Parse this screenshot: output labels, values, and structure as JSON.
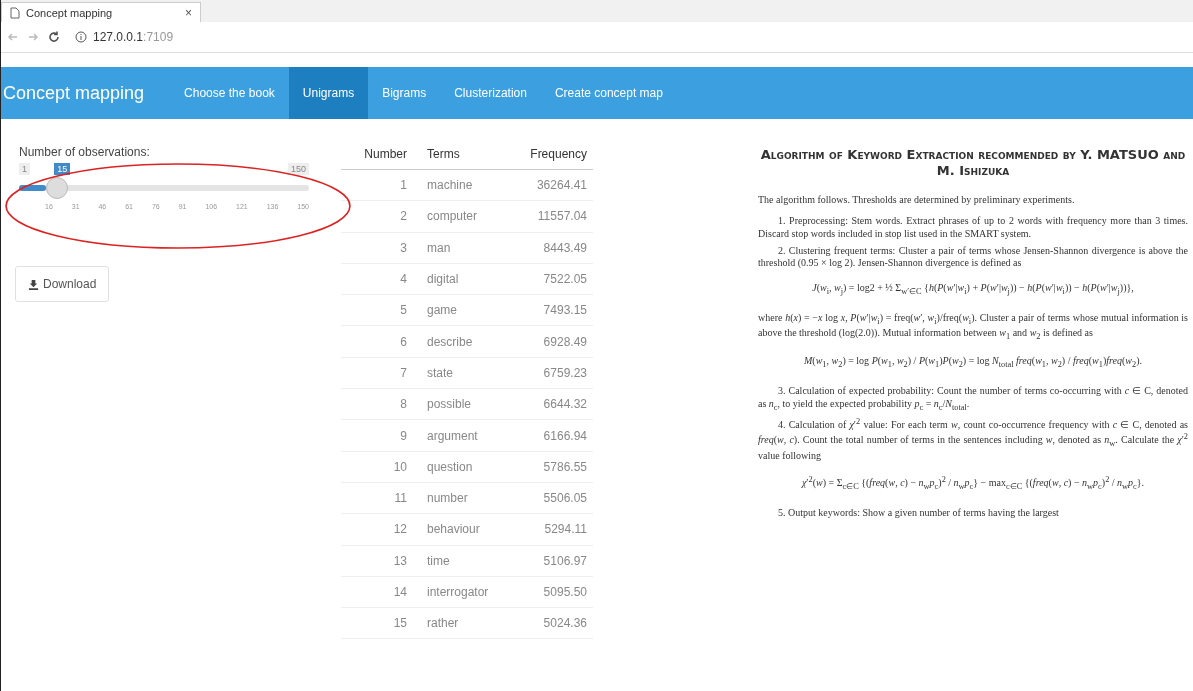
{
  "browser": {
    "tab_title": "Concept mapping",
    "tab_close": "×",
    "address_host": "127.0.0.1",
    "address_port": ":7109"
  },
  "navbar": {
    "brand": "Concept mapping",
    "tabs": [
      {
        "label": "Choose the book",
        "selected": false
      },
      {
        "label": "Unigrams",
        "selected": true
      },
      {
        "label": "Bigrams",
        "selected": false
      },
      {
        "label": "Clusterization",
        "selected": false
      },
      {
        "label": "Create concept map",
        "selected": false
      }
    ]
  },
  "slider": {
    "label": "Number of observations:",
    "min": "1",
    "max": "150",
    "value": "15",
    "level": 0.094,
    "ticks": [
      "16",
      "31",
      "46",
      "61",
      "76",
      "91",
      "106",
      "121",
      "136",
      "150"
    ]
  },
  "download_button": {
    "label": "Download"
  },
  "table": {
    "columns": [
      "Number",
      "Terms",
      "Frequency"
    ],
    "rows": [
      [
        "1",
        "machine",
        "36264.41"
      ],
      [
        "2",
        "computer",
        "11557.04"
      ],
      [
        "3",
        "man",
        "8443.49"
      ],
      [
        "4",
        "digital",
        "7522.05"
      ],
      [
        "5",
        "game",
        "7493.15"
      ],
      [
        "6",
        "describe",
        "6928.49"
      ],
      [
        "7",
        "state",
        "6759.23"
      ],
      [
        "8",
        "possible",
        "6644.32"
      ],
      [
        "9",
        "argument",
        "6166.94"
      ],
      [
        "10",
        "question",
        "5786.55"
      ],
      [
        "11",
        "number",
        "5506.05"
      ],
      [
        "12",
        "behaviour",
        "5294.11"
      ],
      [
        "13",
        "time",
        "5106.97"
      ],
      [
        "14",
        "interrogator",
        "5095.50"
      ],
      [
        "15",
        "rather",
        "5024.36"
      ]
    ]
  },
  "document": {
    "title": "Algorithm of Keyword Extraction recommended by Y. MATSUO and M. Ishizuka",
    "blocks": [
      {
        "kind": "text",
        "text": "The algorithm follows. Thresholds are determined by preliminary experiments."
      },
      {
        "kind": "para",
        "text": "1. Preprocessing: Stem words. Extract phrases of up to 2 words with frequency more than 3 times. Discard stop words included in stop list used in the SMART system."
      },
      {
        "kind": "para",
        "text": "2. Clustering frequent terms: Cluster a pair of terms whose Jensen-Shannon divergence is above the threshold (0.95 × log 2). Jensen-Shannon divergence is defined as"
      },
      {
        "kind": "formula",
        "text": "*J*(*w*$_{i}$, *w*$_{j}$) = log2 + ½ Σ$_{w′∈C}$ {*h*(*P*(*w*′|*w*$_{i}$) + *P*(*w*′|*w*$_{j}$)) − *h*(*P*(*w*′|*w*$_{i}$)) − *h*(*P*(*w*′|*w*$_{j}$))},"
      },
      {
        "kind": "text",
        "text": "where *h*(*x*) = −*x* log *x*, *P*(*w*′|*w*$_{i}$) = freq(*w*′, *w*$_{i}$)/freq(*w*$_{i}$). Cluster a pair of terms whose mutual information is above the threshold (log(2.0)). Mutual information between *w*$_{1}$ and *w*$_{2}$ is defined as"
      },
      {
        "kind": "formula",
        "text": "*M*(*w*$_{1}$, *w*$_{2}$) = log *P*(*w*$_{1}$, *w*$_{2}$) / *P*(*w*$_{1}$)*P*(*w*$_{2}$) = log *N*$_{total}$ *freq*(*w*$_{1}$, *w*$_{2}$) / *freq*(*w*$_{1}$)*freq*(*w*$_{2}$)."
      },
      {
        "kind": "para",
        "text": "3. Calculation of expected probability: Count the number of terms co-occurring with *c* ∈ C, denoted as *n*$_{c}$, to yield the expected probability *p*$_{c}$ = *n*$_{c}$/*N*$_{total}$."
      },
      {
        "kind": "para",
        "text": "4. Calculation of *χ*′$^{2}$ value: For each term *w*, count co-occurrence frequency with *c* ∈ C, denoted as *freq*(*w*, *c*). Count the total number of terms in the sentences including *w*, denoted as *n*$_{w}$. Calculate the *χ*′$^{2}$ value following"
      },
      {
        "kind": "formula",
        "text": "*χ*′$^{2}$(*w*) = Σ$_{c∈C}$ {(*freq*(*w*, *c*) − *n*$_{w}$*p*$_{c}$)$^{2}$ / *n*$_{w}$*p*$_{c}$} − max$_{c∈C}$ {(*freq*(*w*, *c*) − *n*$_{w}$*p*$_{c}$)$^{2}$ / *n*$_{w}$*p*$_{c}$}."
      },
      {
        "kind": "para",
        "text": "5. Output keywords: Show a given number of terms having the largest"
      }
    ]
  }
}
